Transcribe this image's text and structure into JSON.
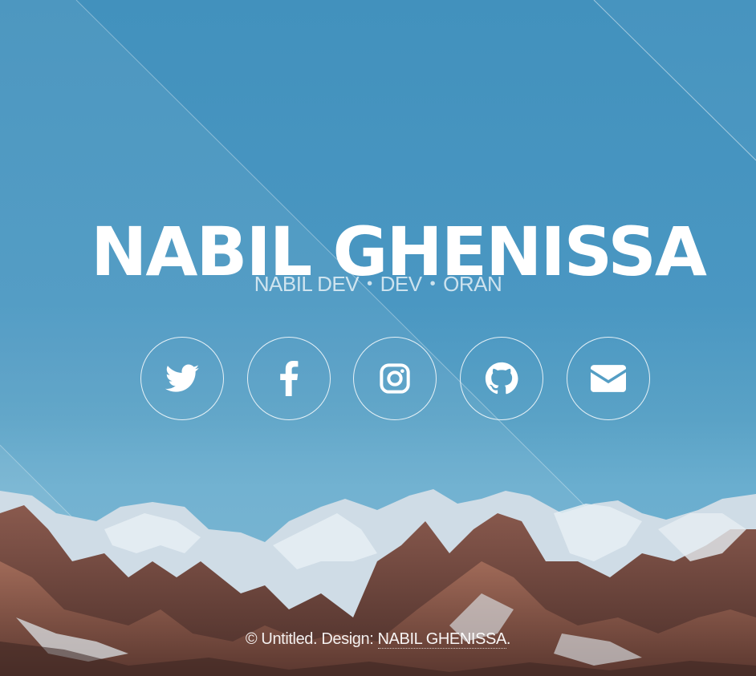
{
  "site": {
    "title": "NABIL GHENISSA",
    "subtitle": {
      "items": [
        "NABIL DEV",
        "DEV",
        "ORAN"
      ],
      "separator": "•"
    }
  },
  "socials": [
    {
      "name": "Twitter",
      "icon": "twitter-icon"
    },
    {
      "name": "Facebook",
      "icon": "facebook-icon"
    },
    {
      "name": "Instagram",
      "icon": "instagram-icon"
    },
    {
      "name": "GitHub",
      "icon": "github-icon"
    },
    {
      "name": "Email",
      "icon": "envelope-icon"
    }
  ],
  "footer": {
    "prefix": "© Untitled. Design: ",
    "link_text": "NABIL GHENISSA",
    "suffix": "."
  },
  "colors": {
    "sky_top": "#4291bd",
    "sky_bottom": "#77b3cf",
    "text": "#ffffff"
  }
}
